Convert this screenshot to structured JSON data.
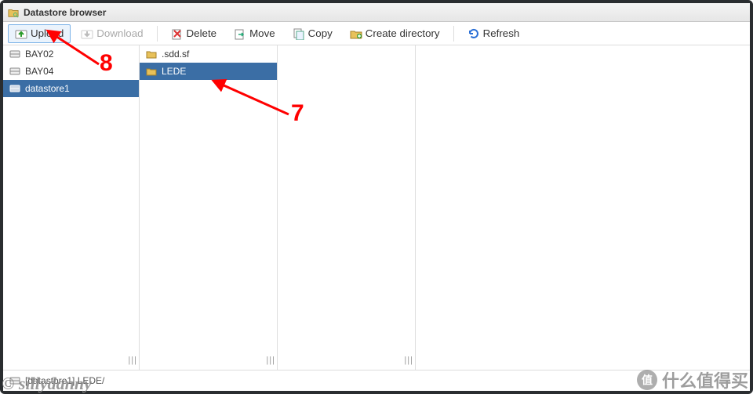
{
  "window": {
    "title": "Datastore browser"
  },
  "toolbar": {
    "upload": "Upload",
    "download": "Download",
    "delete": "Delete",
    "move": "Move",
    "copy": "Copy",
    "create_dir": "Create directory",
    "refresh": "Refresh"
  },
  "datastores": [
    {
      "name": "BAY02",
      "selected": false
    },
    {
      "name": "BAY04",
      "selected": false
    },
    {
      "name": "datastore1",
      "selected": true
    }
  ],
  "folders": [
    {
      "name": ".sdd.sf",
      "selected": false
    },
    {
      "name": "LEDE",
      "selected": true
    }
  ],
  "status": {
    "path": "[datastore1] LEDE/"
  },
  "annotations": {
    "a7": "7",
    "a8": "8"
  },
  "watermark": {
    "left": "© sillydanny",
    "right_text": "什么值得买",
    "right_badge": "值"
  },
  "colors": {
    "select_bg": "#3b6ea5",
    "red": "#ff0000",
    "frame": "#2a2d30"
  }
}
